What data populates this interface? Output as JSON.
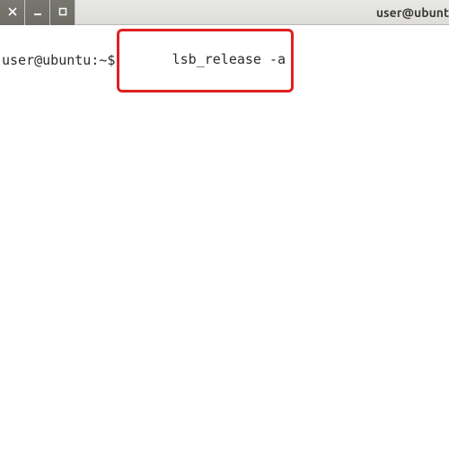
{
  "window": {
    "title": "user@ubunt"
  },
  "terminal": {
    "prompt": "user@ubuntu:~$",
    "command": "lsb_release -a"
  },
  "highlight": {
    "color": "#e02020"
  }
}
